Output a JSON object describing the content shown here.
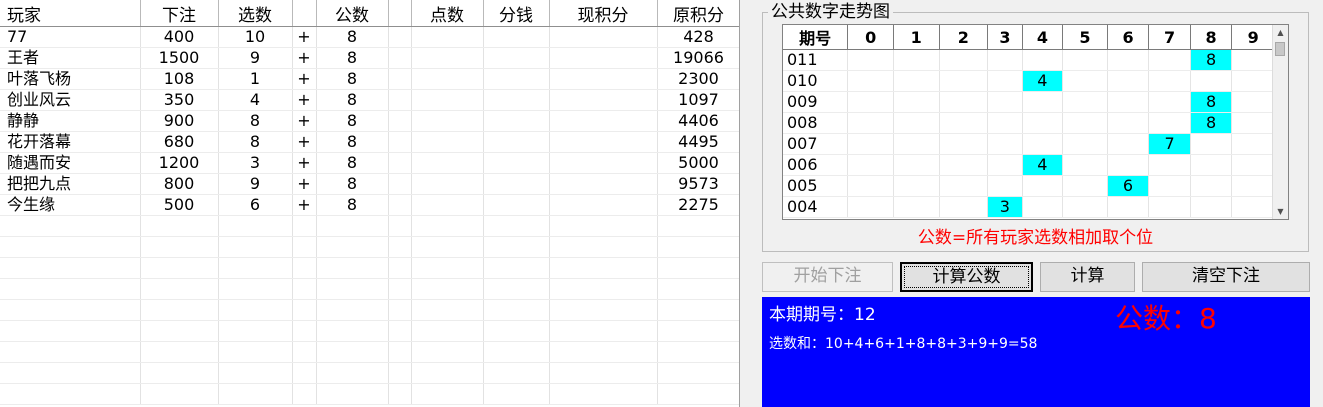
{
  "grid": {
    "headers": [
      "玩家",
      "下注",
      "选数",
      "",
      "公数",
      "",
      "点数",
      "分钱",
      "现积分",
      "原积分"
    ],
    "rows": [
      {
        "player": "77",
        "bet": "400",
        "pick": "10",
        "op": "+",
        "pub": "8",
        "orig": "428"
      },
      {
        "player": "王者",
        "bet": "1500",
        "pick": "9",
        "op": "+",
        "pub": "8",
        "orig": "19066"
      },
      {
        "player": "叶落飞杨",
        "bet": "108",
        "pick": "1",
        "op": "+",
        "pub": "8",
        "orig": "2300"
      },
      {
        "player": "创业风云",
        "bet": "350",
        "pick": "4",
        "op": "+",
        "pub": "8",
        "orig": "1097"
      },
      {
        "player": "静静",
        "bet": "900",
        "pick": "8",
        "op": "+",
        "pub": "8",
        "orig": "4406"
      },
      {
        "player": "花开落幕",
        "bet": "680",
        "pick": "8",
        "op": "+",
        "pub": "8",
        "orig": "4495"
      },
      {
        "player": "随遇而安",
        "bet": "1200",
        "pick": "3",
        "op": "+",
        "pub": "8",
        "orig": "5000"
      },
      {
        "player": "把把九点",
        "bet": "800",
        "pick": "9",
        "op": "+",
        "pub": "8",
        "orig": "9573"
      },
      {
        "player": "今生缘",
        "bet": "500",
        "pick": "6",
        "op": "+",
        "pub": "8",
        "orig": "2275"
      }
    ],
    "blank_rows": 9
  },
  "trend": {
    "title": "公共数字走势图",
    "headers": [
      "期号",
      "0",
      "1",
      "2",
      "3",
      "4",
      "5",
      "6",
      "7",
      "8",
      "9"
    ],
    "rows": [
      {
        "period": "011",
        "hit": "8"
      },
      {
        "period": "010",
        "hit": "4"
      },
      {
        "period": "009",
        "hit": "8"
      },
      {
        "period": "008",
        "hit": "8"
      },
      {
        "period": "007",
        "hit": "7"
      },
      {
        "period": "006",
        "hit": "4"
      },
      {
        "period": "005",
        "hit": "6"
      },
      {
        "period": "004",
        "hit": "3"
      }
    ],
    "note": "公数=所有玩家选数相加取个位",
    "highlight_color": "#00ffff"
  },
  "buttons": {
    "start_bet": "开始下注",
    "calc_public": "计算公数",
    "calc": "计算",
    "clear_bet": "清空下注"
  },
  "panel": {
    "period_label": "本期期号：12",
    "sum_label": "选数和：10+4+6+1+8+8+3+9+9=58",
    "public_label": "公数：8",
    "background": "#0000ff",
    "public_color": "#ff0000"
  }
}
